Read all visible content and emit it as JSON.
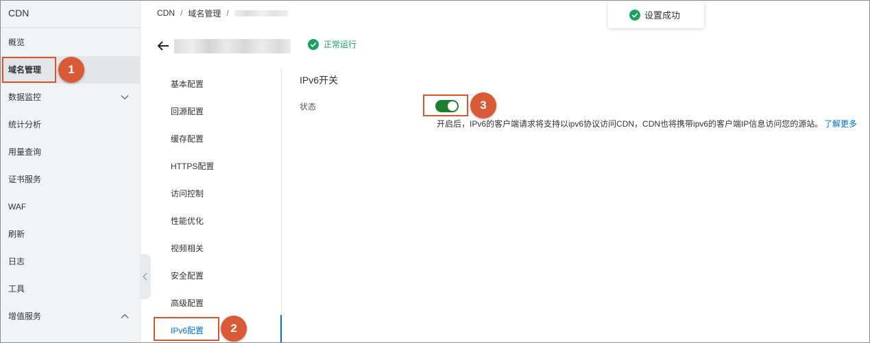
{
  "sidebar": {
    "title": "CDN",
    "items": [
      {
        "label": "概览"
      },
      {
        "label": "域名管理"
      },
      {
        "label": "数据监控"
      },
      {
        "label": "统计分析"
      },
      {
        "label": "用量查询"
      },
      {
        "label": "证书服务"
      },
      {
        "label": "WAF"
      },
      {
        "label": "刷新"
      },
      {
        "label": "日志"
      },
      {
        "label": "工具"
      },
      {
        "label": "增值服务"
      }
    ]
  },
  "breadcrumb": {
    "root": "CDN",
    "separator": "/",
    "section": "域名管理"
  },
  "toast": {
    "message": "设置成功"
  },
  "header": {
    "status": "正常运行"
  },
  "subnav": {
    "items": [
      {
        "label": "基本配置"
      },
      {
        "label": "回源配置"
      },
      {
        "label": "缓存配置"
      },
      {
        "label": "HTTPS配置"
      },
      {
        "label": "访问控制"
      },
      {
        "label": "性能优化"
      },
      {
        "label": "视频相关"
      },
      {
        "label": "安全配置"
      },
      {
        "label": "高级配置"
      },
      {
        "label": "IPv6配置"
      }
    ]
  },
  "content": {
    "section_title": "IPv6开关",
    "status_label": "状态",
    "toggle_on": true,
    "description": "开启后，IPv6的客户端请求将支持以ipv6协议访问CDN，CDN也将携带ipv6的客户端IP信息访问您的源站。",
    "learn_more": "了解更多"
  },
  "annotations": {
    "badge_1": "1",
    "badge_2": "2",
    "badge_3": "3"
  },
  "colors": {
    "accent": "#0070cc",
    "success": "#1ba160",
    "toggle_on": "#1f7d2e",
    "annotation": "#d9552c"
  }
}
